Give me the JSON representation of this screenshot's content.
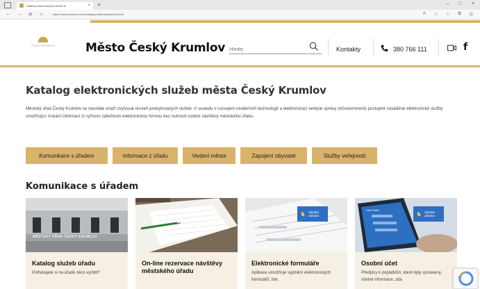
{
  "browser": {
    "tab_title": "Katalog elektronických služeb m",
    "tab_close": "×",
    "new_tab": "+",
    "url": "https://www.ckrumlov.cz/cz/katalog-elektronickych-sluzeb/",
    "window_controls": [
      "–",
      "□",
      "×"
    ],
    "nav": {
      "back": "←",
      "forward": "→",
      "reload": "⟳",
      "home": "⌂"
    }
  },
  "header": {
    "logo_text": "ČESKÝ KRUMLOV",
    "site_title": "Město Český Krumlov",
    "search_placeholder": "Hledej",
    "contacts_label": "Kontakty",
    "phone_number": "380 766 111",
    "facebook_label": "f",
    "accent_color": "#d9b36a"
  },
  "main": {
    "page_title": "Katalog elektronických služeb města Český Krumlov",
    "intro": "Městský úřad Český Krumlov se neustále snaží zvyšovat úroveň poskytovaných služeb. V souladu s rozvojem moderních technologií a elektronizací veřejné správy (eGovernment) postupně zavádíme elektronické služby umožňující získání informací či vyřízení záležitostí elektronickou formou bez nutnosti osobní návštěvy městského úřadu.",
    "categories": [
      "Komunikace s úřadem",
      "Informace z úřadu",
      "Vedení města",
      "Zapojení obyvatel",
      "Služby veřejnosti"
    ],
    "section_title": "Komunikace s úřadem",
    "cards": [
      {
        "title": "Katalog služeb úřadu",
        "desc": "Potřebujete si na úřadě něco vyřídit?",
        "image_text": "MĚSTSKÝ ÚŘAD ČESKÝ KRUMLOV"
      },
      {
        "title": "On-line rezervace návštěvy městského úřadu",
        "desc": ""
      },
      {
        "title": "Elektronické formuláře",
        "desc": "Aplikace umožňuje vyplnění elektronických formulářů, tisk,",
        "badge": "Identita občana"
      },
      {
        "title": "Osobní účet",
        "desc": "Předpisy k poplatkům, které byly vystaveny, včetně informace, zda",
        "badge": "Identita občana",
        "tablet_text": "Váš Portál"
      }
    ]
  }
}
